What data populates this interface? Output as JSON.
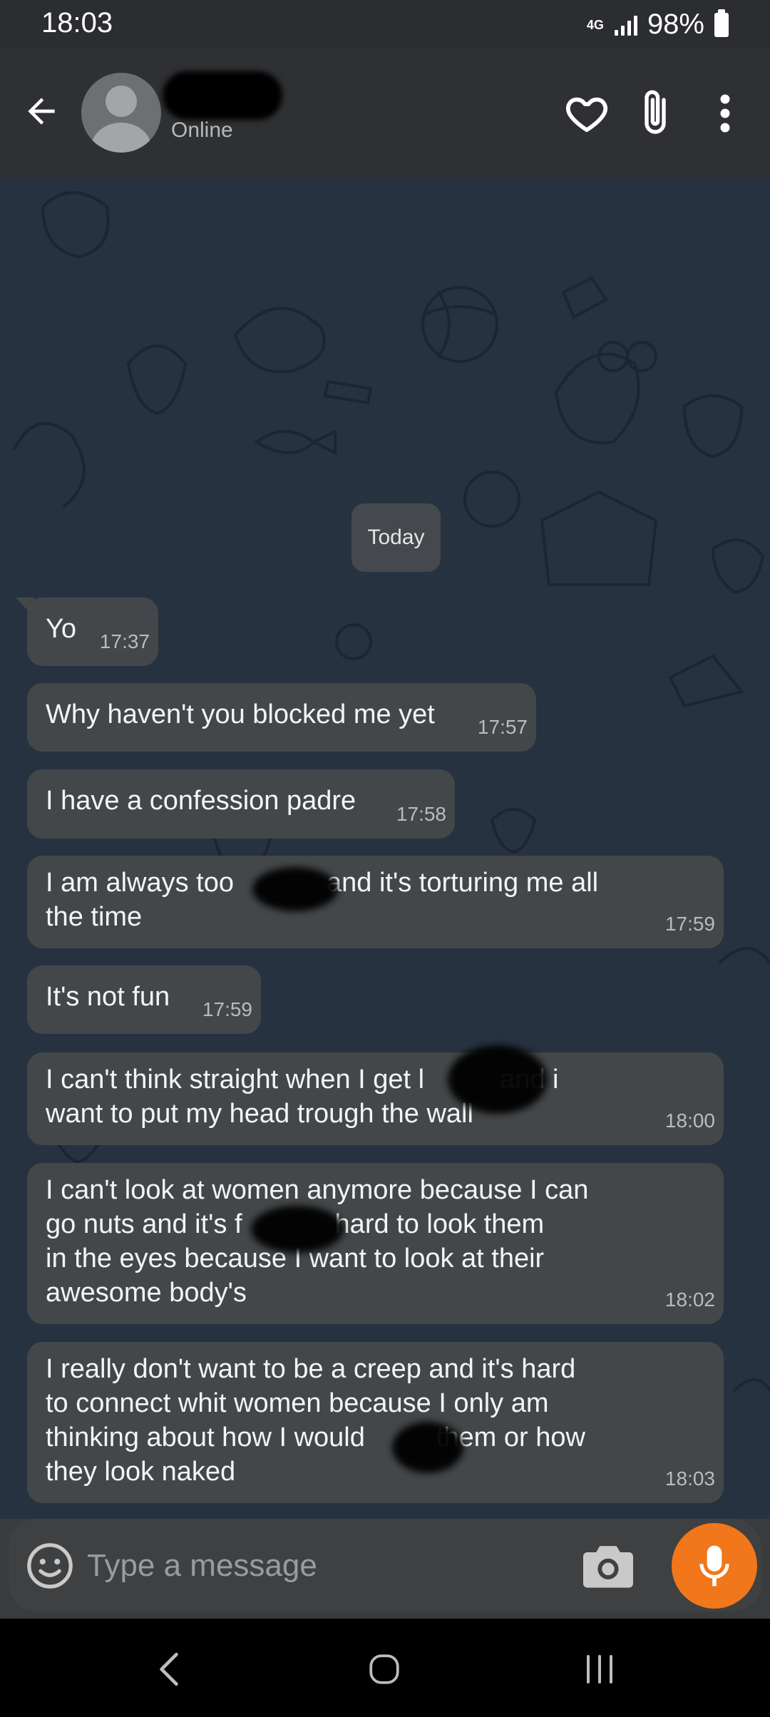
{
  "status_bar": {
    "time": "18:03",
    "network": "4G",
    "battery": "98%"
  },
  "header": {
    "contact_status": "Online",
    "icons": [
      "back-arrow-icon",
      "heart-icon",
      "paperclip-icon",
      "more-vertical-icon"
    ]
  },
  "chat": {
    "date_divider": "Today",
    "messages": [
      {
        "text": "Yo",
        "time": "17:37"
      },
      {
        "text": "Why haven't you blocked me yet",
        "time": "17:57"
      },
      {
        "text": "I have a confession padre",
        "time": "17:58"
      },
      {
        "line1": "I am always too",
        "line1b": "and it's torturing me all",
        "line2": "the time",
        "time": "17:59"
      },
      {
        "text": "It's not fun",
        "time": "17:59"
      },
      {
        "line1": "I can't think straight when I get l",
        "line1b": "and i",
        "line2": "want to put my head trough the wall",
        "time": "18:00"
      },
      {
        "line1": "I can't look at women anymore because I can",
        "line2": "go nuts and it's f",
        "line2b": "hard to look them",
        "line3": "in the eyes because I want to look at their",
        "line4": "awesome body's",
        "time": "18:02"
      },
      {
        "line1": "I really don't want to be a creep and it's hard",
        "line2": "to connect whit women because I only am",
        "line3": "thinking about how I would",
        "line3b": "them or how",
        "line4": "they look naked",
        "time": "18:03"
      }
    ]
  },
  "composer": {
    "placeholder": "Type a message",
    "icons": [
      "emoji-icon",
      "camera-icon",
      "microphone-icon"
    ],
    "mic_color": "#f2761a"
  },
  "colors": {
    "chat_background": "#263240",
    "bubble": "#444749",
    "app_bar": "#2f3033"
  }
}
